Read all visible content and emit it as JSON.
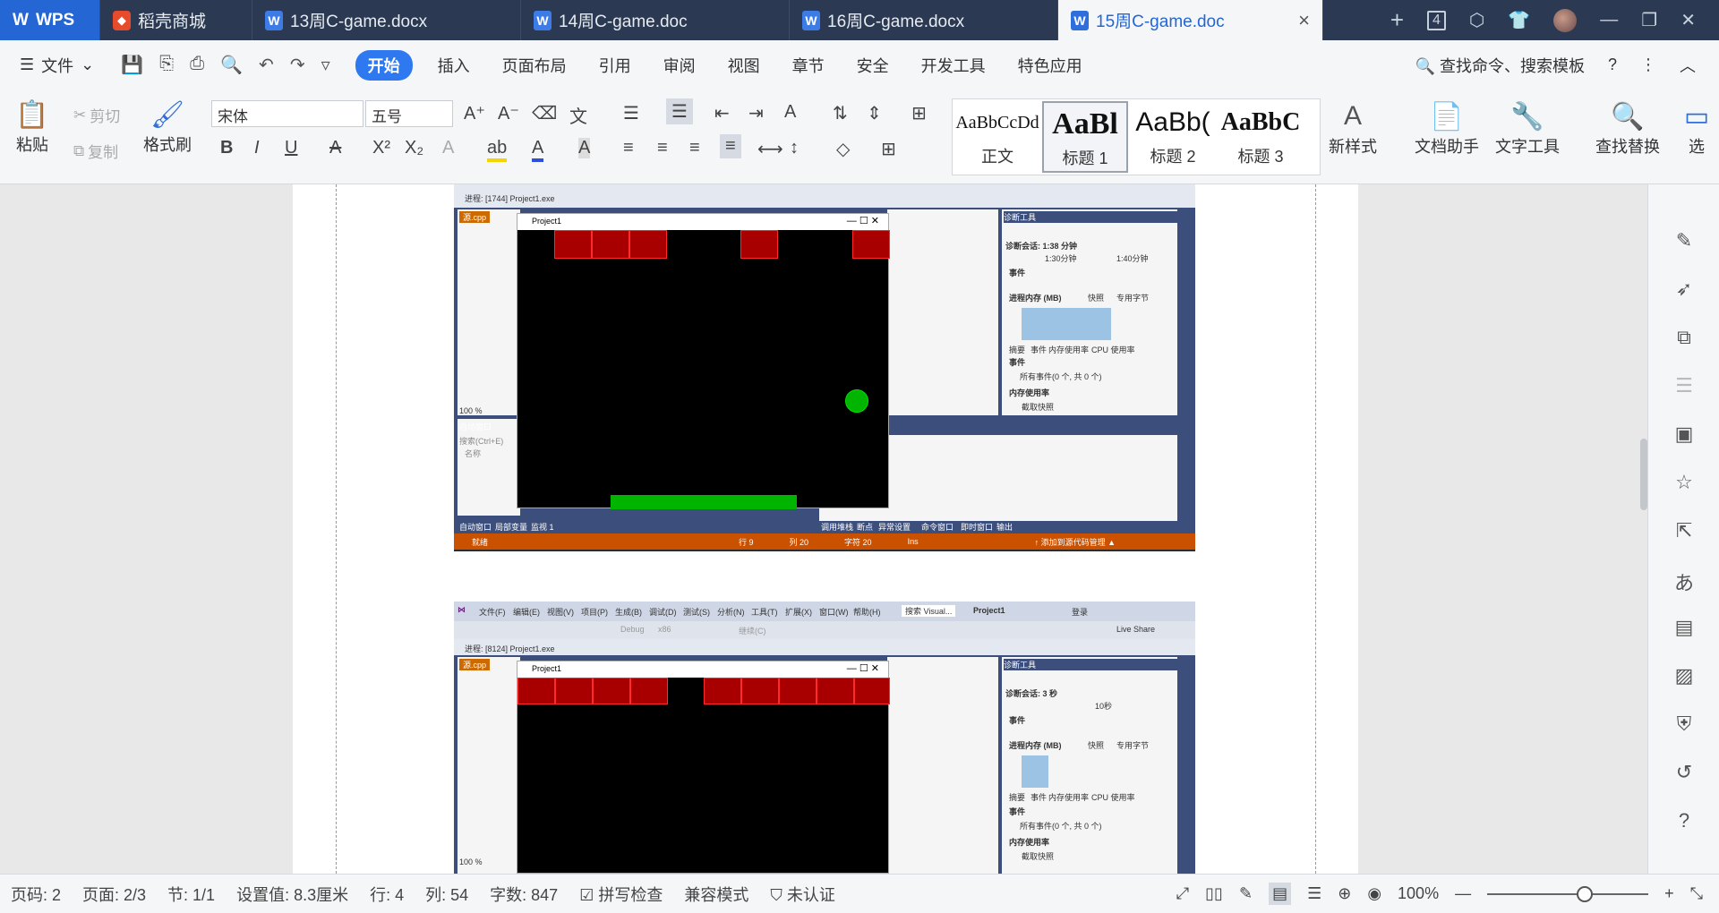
{
  "tabs": {
    "wps": "WPS",
    "items": [
      {
        "label": "稻壳商城",
        "icon": "daoke-icon"
      },
      {
        "label": "13周C-game.docx",
        "icon": "word-doc-icon"
      },
      {
        "label": "14周C-game.doc",
        "icon": "word-doc-icon"
      },
      {
        "label": "16周C-game.docx",
        "icon": "word-doc-icon"
      },
      {
        "label": "15周C-game.doc",
        "icon": "word-doc-icon",
        "active": true
      }
    ],
    "window_count": "4",
    "add": "+",
    "close": "×"
  },
  "menu": {
    "file": "文件",
    "items": [
      "开始",
      "插入",
      "页面布局",
      "引用",
      "审阅",
      "视图",
      "章节",
      "安全",
      "开发工具",
      "特色应用"
    ],
    "search": "查找命令、搜索模板"
  },
  "ribbon": {
    "paste": "粘贴",
    "cut": "剪切",
    "copy": "复制",
    "format_painter": "格式刷",
    "font_name": "宋体",
    "font_size": "五号",
    "styles": [
      {
        "preview": "AaBbCcDd",
        "label": "正文"
      },
      {
        "preview": "AaBl",
        "label": "标题 1"
      },
      {
        "preview": "AaBb(",
        "label": "标题 2"
      },
      {
        "preview": "AaBbC",
        "label": "标题 3"
      }
    ],
    "new_style": "新样式",
    "doc_assistant": "文档助手",
    "text_tools": "文字工具",
    "find_replace": "查找替换",
    "select": "选"
  },
  "screenshots": [
    {
      "process": "进程: [1744] Project1.exe",
      "game_title": "Project1",
      "panel_title": "诊断工具",
      "session": "诊断会话: 1:38 分钟",
      "time_a": "1:30分钟",
      "time_b": "1:40分钟",
      "events": "事件",
      "memory": "进程内存 (MB)",
      "legend_a": "快照",
      "legend_b": "专用字节",
      "tab_labels": [
        "摘要",
        "事件",
        "内存使用率",
        "CPU 使用率"
      ],
      "all_events": "所有事件(0 个, 共 0 个)",
      "mem_usage": "内存使用率",
      "snapshot": "截取快照",
      "auto_window": "自动窗口",
      "search_hint": "搜索(Ctrl+E)",
      "name_col": "名称",
      "bottom_tabs": [
        "自动窗口",
        "局部变量",
        "监视 1"
      ],
      "bottom_tabs_right": [
        "调用堆栈",
        "断点",
        "异常设置",
        "命令窗口",
        "即时窗口",
        "输出"
      ],
      "status_ready": "就绪",
      "status_line": "行 9",
      "status_col": "列 20",
      "status_char": "字符 20",
      "status_ins": "Ins",
      "status_src": "↑ 添加到源代码管理 ▲",
      "source_tab": "源.cpp",
      "zoom": "100 %"
    },
    {
      "menus": [
        "文件(F)",
        "编辑(E)",
        "视图(V)",
        "项目(P)",
        "生成(B)",
        "调试(D)",
        "测试(S)",
        "分析(N)",
        "工具(T)",
        "扩展(X)",
        "窗口(W)",
        "帮助(H)"
      ],
      "search_vs": "搜索 Visual...",
      "project": "Project1",
      "login": "登录",
      "config": "Debug",
      "platform": "x86",
      "continue": "继续(C)",
      "live_share": "Live Share",
      "process": "进程: [8124] Project1.exe",
      "game_title": "Project1",
      "panel_title": "诊断工具",
      "session": "诊断会话: 3 秒",
      "time_a": "10秒",
      "events": "事件",
      "memory": "进程内存 (MB)",
      "legend_a": "快照",
      "legend_b": "专用字节",
      "tab_labels": [
        "摘要",
        "事件",
        "内存使用率",
        "CPU 使用率"
      ],
      "all_events": "所有事件(0 个, 共 0 个)",
      "mem_usage": "内存使用率",
      "snapshot": "截取快照",
      "source_tab": "源.cpp",
      "zoom": "100 %"
    }
  ],
  "status": {
    "page_code": "页码: 2",
    "page": "页面: 2/3",
    "section": "节: 1/1",
    "setting": "设置值: 8.3厘米",
    "row": "行: 4",
    "col": "列: 54",
    "words": "字数: 847",
    "spell": "拼写检查",
    "compat": "兼容模式",
    "cert": "未认证",
    "zoom": "100%"
  },
  "colors": {
    "accent": "#2f79f0",
    "brick": "#a80000",
    "ball": "#00b400",
    "vs_status": "#ca5100"
  }
}
